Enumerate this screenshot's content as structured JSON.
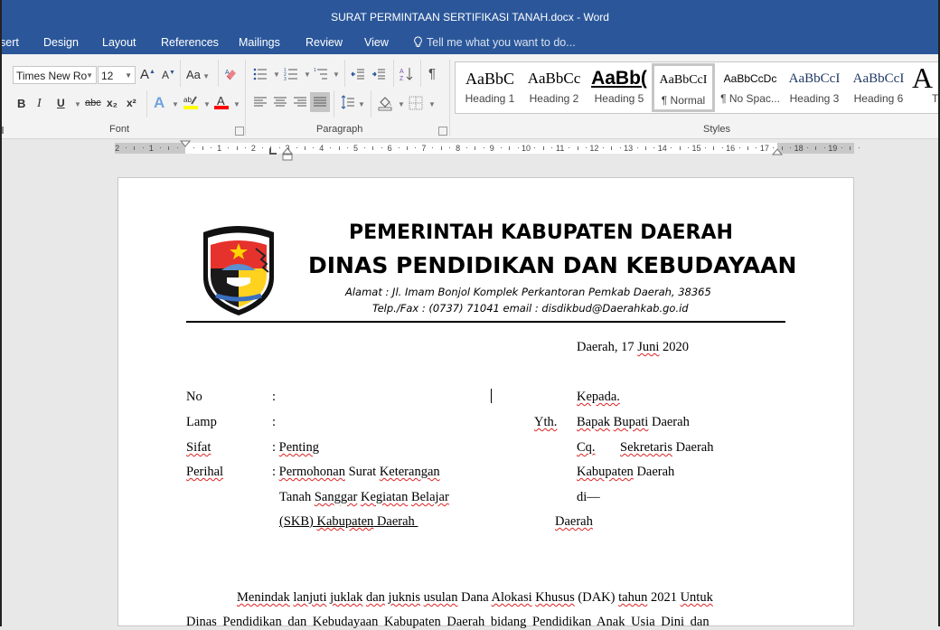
{
  "window": {
    "title": "SURAT PERMINTAAN SERTIFIKASI TANAH.docx - Word"
  },
  "tabs": [
    {
      "label": "sert"
    },
    {
      "label": "Design"
    },
    {
      "label": "Layout"
    },
    {
      "label": "References"
    },
    {
      "label": "Mailings"
    },
    {
      "label": "Review"
    },
    {
      "label": "View"
    }
  ],
  "tell_me": {
    "placeholder": "Tell me what you want to do..."
  },
  "ribbon": {
    "font": {
      "group_label": "Font",
      "font_name": "Times New Ro",
      "font_size": "12",
      "change_case": "Aa",
      "bold": "B",
      "italic": "I",
      "underline": "U",
      "strikethrough": "abc",
      "subscript": "x₂",
      "superscript": "x²",
      "highlight_color": "#ffff00",
      "font_color": "#ff0000"
    },
    "paragraph": {
      "group_label": "Paragraph",
      "active_alignment": "justify"
    },
    "styles": {
      "group_label": "Styles",
      "items": [
        {
          "preview": "AaBbC",
          "name": "Heading 1"
        },
        {
          "preview": "AaBbCc",
          "name": "Heading 2"
        },
        {
          "preview": "AaBb(",
          "name": "Heading 5"
        },
        {
          "preview": "AaBbCcI",
          "name": "¶ Normal",
          "selected": true
        },
        {
          "preview": "AaBbCcDc",
          "name": "¶ No Spac..."
        },
        {
          "preview": "AaBbCcI",
          "name": "Heading 3"
        },
        {
          "preview": "AaBbCcI",
          "name": "Heading 6"
        },
        {
          "preview": "A",
          "name": "T"
        }
      ]
    }
  },
  "ruler": {
    "labels": [
      "2",
      "1",
      "1",
      "2",
      "3",
      "4",
      "5",
      "6",
      "7",
      "8",
      "9",
      "10",
      "11",
      "12",
      "13",
      "14",
      "15",
      "16",
      "17",
      "18",
      "19"
    ]
  },
  "document": {
    "letterhead": {
      "line1": "PEMERINTAH KABUPATEN DAERAH",
      "line2": "DINAS PENDIDIKAN DAN KEBUDAYAAN",
      "address": "Alamat : Jl. Imam Bonjol Komplek Perkantoran Pemkab Daerah, 38365",
      "contact": "Telp./Fax : (0737) 71041 email : disdikbud@Daerahkab.go.id"
    },
    "date": {
      "place": "Daerah, 17 ",
      "month": "Juni",
      "year": " 2020"
    },
    "fields": [
      {
        "label": "No",
        "value": ": "
      },
      {
        "label": "Lamp",
        "value": ": "
      },
      {
        "label": "Sifat",
        "value": ": Penting"
      },
      {
        "label": "Perihal",
        "value": ": Permohonan Surat Keterangan"
      }
    ],
    "perihal_cont": [
      "Tanah Sanggar Kegiatan Belajar",
      "(SKB) Kabupaten Daerah "
    ],
    "recipient": {
      "kepada": "Kepada.",
      "yth": "Yth.",
      "line1": "Bapak Bupati Daerah",
      "cq": "Cq.",
      "line2": "Sekretaris Daerah",
      "line3": "Kabupaten Daerah",
      "di": "di—",
      "city": "Daerah"
    },
    "body": [
      "Menindak lanjuti juklak dan juknis usulan Dana Alokasi Khusus (DAK) tahun 2021 Untuk",
      "Dinas Pendidikan dan Kebudayaan Kabupaten Daerah bidang Pendidikan Anak Usia Dini dan"
    ]
  }
}
